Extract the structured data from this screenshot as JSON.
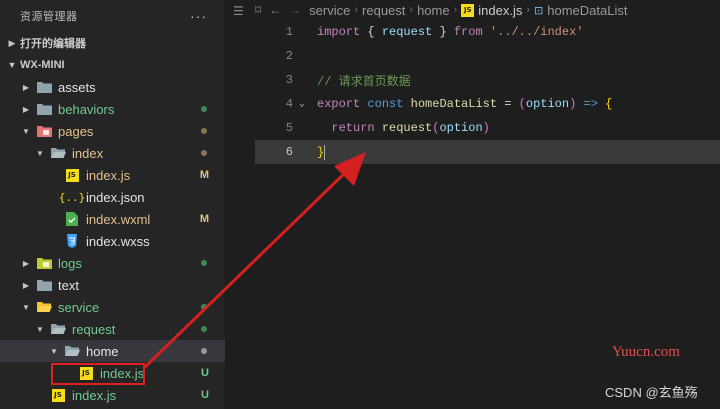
{
  "sidebar": {
    "title": "资源管理器",
    "more": "···",
    "open_editors": "打开的编辑器",
    "project": "WX-MINI",
    "tree": [
      {
        "label": "assets",
        "depth": 1,
        "type": "folder",
        "expanded": false,
        "color": "white",
        "status": "",
        "dot": "",
        "icon": "folder-icon"
      },
      {
        "label": "behaviors",
        "depth": 1,
        "type": "folder",
        "expanded": false,
        "color": "green",
        "status": "",
        "dot": "#3c8a55",
        "icon": "folder-icon"
      },
      {
        "label": "pages",
        "depth": 1,
        "type": "folder",
        "expanded": true,
        "color": "mod",
        "status": "",
        "dot": "#8a7553",
        "icon": "pages-folder-icon"
      },
      {
        "label": "index",
        "depth": 2,
        "type": "folder",
        "expanded": true,
        "color": "mod",
        "status": "",
        "dot": "#8a7553",
        "icon": "folder-open-icon"
      },
      {
        "label": "index.js",
        "depth": 3,
        "type": "js",
        "color": "mod",
        "status": "M",
        "dot": "",
        "icon": "js-file-icon"
      },
      {
        "label": "index.json",
        "depth": 3,
        "type": "json",
        "color": "white",
        "status": "",
        "dot": "",
        "icon": "json-file-icon"
      },
      {
        "label": "index.wxml",
        "depth": 3,
        "type": "wxml",
        "color": "mod",
        "status": "M",
        "dot": "",
        "icon": "wxml-file-icon"
      },
      {
        "label": "index.wxss",
        "depth": 3,
        "type": "wxss",
        "color": "white",
        "status": "",
        "dot": "",
        "icon": "css-file-icon"
      },
      {
        "label": "logs",
        "depth": 1,
        "type": "folder",
        "expanded": false,
        "color": "green",
        "status": "",
        "dot": "#3c8a55",
        "icon": "logs-folder-icon"
      },
      {
        "label": "text",
        "depth": 1,
        "type": "folder",
        "expanded": false,
        "color": "white",
        "status": "",
        "dot": "",
        "icon": "folder-icon"
      },
      {
        "label": "service",
        "depth": 1,
        "type": "folder",
        "expanded": true,
        "color": "green",
        "status": "",
        "dot": "#3c8a55",
        "icon": "service-folder-icon"
      },
      {
        "label": "request",
        "depth": 2,
        "type": "folder",
        "expanded": true,
        "color": "green",
        "status": "",
        "dot": "#3c8a55",
        "icon": "folder-open-icon"
      },
      {
        "label": "home",
        "depth": 3,
        "type": "folder",
        "expanded": true,
        "color": "white",
        "status": "",
        "dot": "#9a9a9a",
        "icon": "folder-open-icon",
        "selected": true
      },
      {
        "label": "index.js",
        "depth": 4,
        "type": "js",
        "color": "green",
        "status": "U",
        "dot": "",
        "icon": "js-file-icon"
      },
      {
        "label": "index.js",
        "depth": 2,
        "type": "js",
        "color": "green",
        "status": "U",
        "dot": "",
        "icon": "js-file-icon"
      }
    ]
  },
  "breadcrumb": [
    "service",
    "request",
    "home",
    "index.js",
    "homeDataList"
  ],
  "code": [
    {
      "n": "1",
      "tokens": [
        [
          "kw2",
          "import"
        ],
        [
          "pun",
          " { "
        ],
        [
          "var",
          "request"
        ],
        [
          "pun",
          " } "
        ],
        [
          "kw2",
          "from"
        ],
        [
          "pun",
          " "
        ],
        [
          "str",
          "'../../index'"
        ]
      ]
    },
    {
      "n": "2",
      "tokens": []
    },
    {
      "n": "3",
      "tokens": [
        [
          "cmt",
          "// 请求首页数据"
        ]
      ]
    },
    {
      "n": "4",
      "fold": true,
      "tokens": [
        [
          "kw2",
          "export"
        ],
        [
          "pun",
          " "
        ],
        [
          "kw",
          "const"
        ],
        [
          "pun",
          " "
        ],
        [
          "fn",
          "homeDataList"
        ],
        [
          "pun",
          " = "
        ],
        [
          "br2",
          "("
        ],
        [
          "var",
          "option"
        ],
        [
          "br2",
          ")"
        ],
        [
          "pun",
          " "
        ],
        [
          "kw",
          "=>"
        ],
        [
          "pun",
          " "
        ],
        [
          "br1",
          "{"
        ]
      ]
    },
    {
      "n": "5",
      "tokens": [
        [
          "pun",
          "  "
        ],
        [
          "kw2",
          "return"
        ],
        [
          "pun",
          " "
        ],
        [
          "fn",
          "request"
        ],
        [
          "br2",
          "("
        ],
        [
          "var",
          "option"
        ],
        [
          "br2",
          ")"
        ]
      ]
    },
    {
      "n": "6",
      "cur": true,
      "tokens": [
        [
          "br1",
          "}"
        ]
      ]
    }
  ],
  "watermark": {
    "site": "Yuucn.com",
    "author": "CSDN @玄鱼殇"
  },
  "colors": {
    "highlight": "#e02020",
    "arrow": "#d42020"
  }
}
